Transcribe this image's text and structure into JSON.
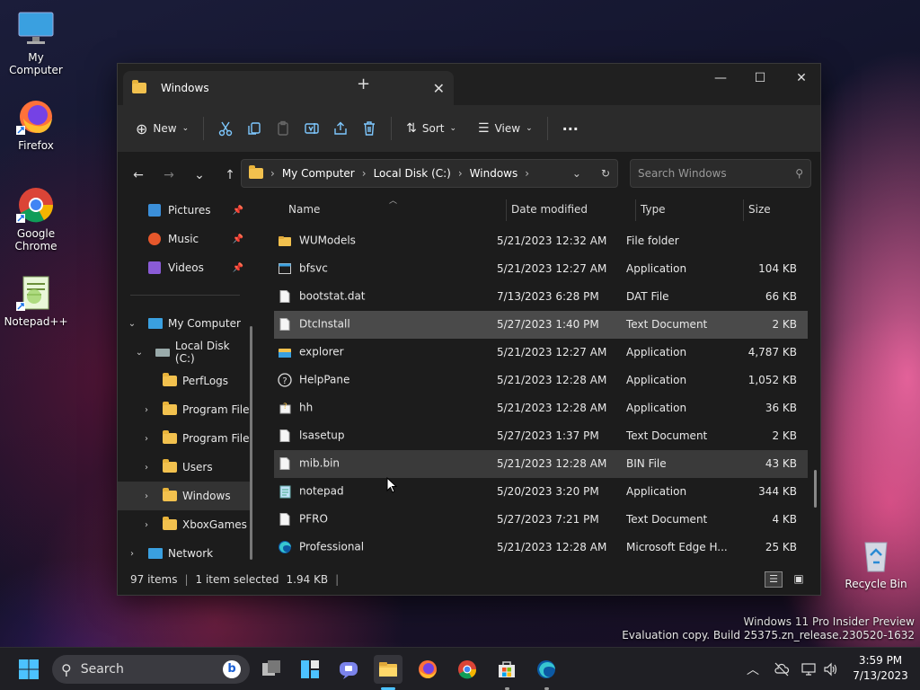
{
  "desktop": {
    "icons": [
      {
        "label": "My Computer",
        "icon": "monitor-icon"
      },
      {
        "label": "Firefox",
        "icon": "firefox-icon"
      },
      {
        "label": "Google Chrome",
        "icon": "chrome-icon"
      },
      {
        "label": "Notepad++",
        "icon": "notepadpp-icon"
      },
      {
        "label": "Recycle Bin",
        "icon": "recycle-bin-icon"
      }
    ],
    "watermark": {
      "line1": "Windows 11 Pro Insider Preview",
      "line2": "Evaluation copy. Build 25375.zn_release.230520-1632"
    }
  },
  "window": {
    "tab_title": "Windows",
    "new_tab": "+",
    "toolbar": {
      "new_label": "New",
      "sort_label": "Sort",
      "view_label": "View",
      "more_label": "···"
    },
    "breadcrumb": [
      "My Computer",
      "Local Disk (C:)",
      "Windows"
    ],
    "search_placeholder": "Search Windows",
    "sidebar": {
      "quick": [
        {
          "label": "Pictures",
          "icon": "pictures-icon"
        },
        {
          "label": "Music",
          "icon": "music-icon"
        },
        {
          "label": "Videos",
          "icon": "videos-icon"
        }
      ],
      "tree": [
        {
          "label": "My Computer",
          "level": 0,
          "chev": "v",
          "icon": "monitor-icon"
        },
        {
          "label": "Local Disk (C:)",
          "level": 1,
          "chev": "v",
          "icon": "drive-icon"
        },
        {
          "label": "PerfLogs",
          "level": 2,
          "chev": "",
          "icon": "folder-icon"
        },
        {
          "label": "Program File",
          "level": 2,
          "chev": ">",
          "icon": "folder-icon"
        },
        {
          "label": "Program File",
          "level": 2,
          "chev": ">",
          "icon": "folder-icon"
        },
        {
          "label": "Users",
          "level": 2,
          "chev": ">",
          "icon": "folder-icon"
        },
        {
          "label": "Windows",
          "level": 2,
          "chev": ">",
          "icon": "folder-icon",
          "selected": true
        },
        {
          "label": "XboxGames",
          "level": 2,
          "chev": ">",
          "icon": "folder-icon"
        },
        {
          "label": "Network",
          "level": 0,
          "chev": ">",
          "icon": "network-icon"
        }
      ]
    },
    "columns": {
      "name": "Name",
      "date": "Date modified",
      "type": "Type",
      "size": "Size"
    },
    "files": [
      {
        "name": "WUModels",
        "date": "5/21/2023 12:32 AM",
        "type": "File folder",
        "size": "",
        "icon": "folder-icon"
      },
      {
        "name": "bfsvc",
        "date": "5/21/2023 12:27 AM",
        "type": "Application",
        "size": "104 KB",
        "icon": "app-icon"
      },
      {
        "name": "bootstat.dat",
        "date": "7/13/2023 6:28 PM",
        "type": "DAT File",
        "size": "66 KB",
        "icon": "file-icon"
      },
      {
        "name": "DtcInstall",
        "date": "5/27/2023 1:40 PM",
        "type": "Text Document",
        "size": "2 KB",
        "icon": "file-icon",
        "selected": true
      },
      {
        "name": "explorer",
        "date": "5/21/2023 12:27 AM",
        "type": "Application",
        "size": "4,787 KB",
        "icon": "explorer-icon"
      },
      {
        "name": "HelpPane",
        "date": "5/21/2023 12:28 AM",
        "type": "Application",
        "size": "1,052 KB",
        "icon": "help-icon"
      },
      {
        "name": "hh",
        "date": "5/21/2023 12:28 AM",
        "type": "Application",
        "size": "36 KB",
        "icon": "hh-icon"
      },
      {
        "name": "lsasetup",
        "date": "5/27/2023 1:37 PM",
        "type": "Text Document",
        "size": "2 KB",
        "icon": "file-icon"
      },
      {
        "name": "mib.bin",
        "date": "5/21/2023 12:28 AM",
        "type": "BIN File",
        "size": "43 KB",
        "icon": "file-icon",
        "hover": true
      },
      {
        "name": "notepad",
        "date": "5/20/2023 3:20 PM",
        "type": "Application",
        "size": "344 KB",
        "icon": "notepad-icon"
      },
      {
        "name": "PFRO",
        "date": "5/27/2023 7:21 PM",
        "type": "Text Document",
        "size": "4 KB",
        "icon": "file-icon"
      },
      {
        "name": "Professional",
        "date": "5/21/2023 12:28 AM",
        "type": "Microsoft Edge H...",
        "size": "25 KB",
        "icon": "edge-icon"
      }
    ],
    "status": {
      "count": "97 items",
      "selected": "1 item selected",
      "size": "1.94 KB"
    }
  },
  "taskbar": {
    "search_label": "Search",
    "time": "3:59 PM",
    "date": "7/13/2023"
  },
  "colors": {
    "folder": "#f2c14e",
    "accent": "#4cc2ff",
    "selected_row": "#4a4a4a"
  }
}
